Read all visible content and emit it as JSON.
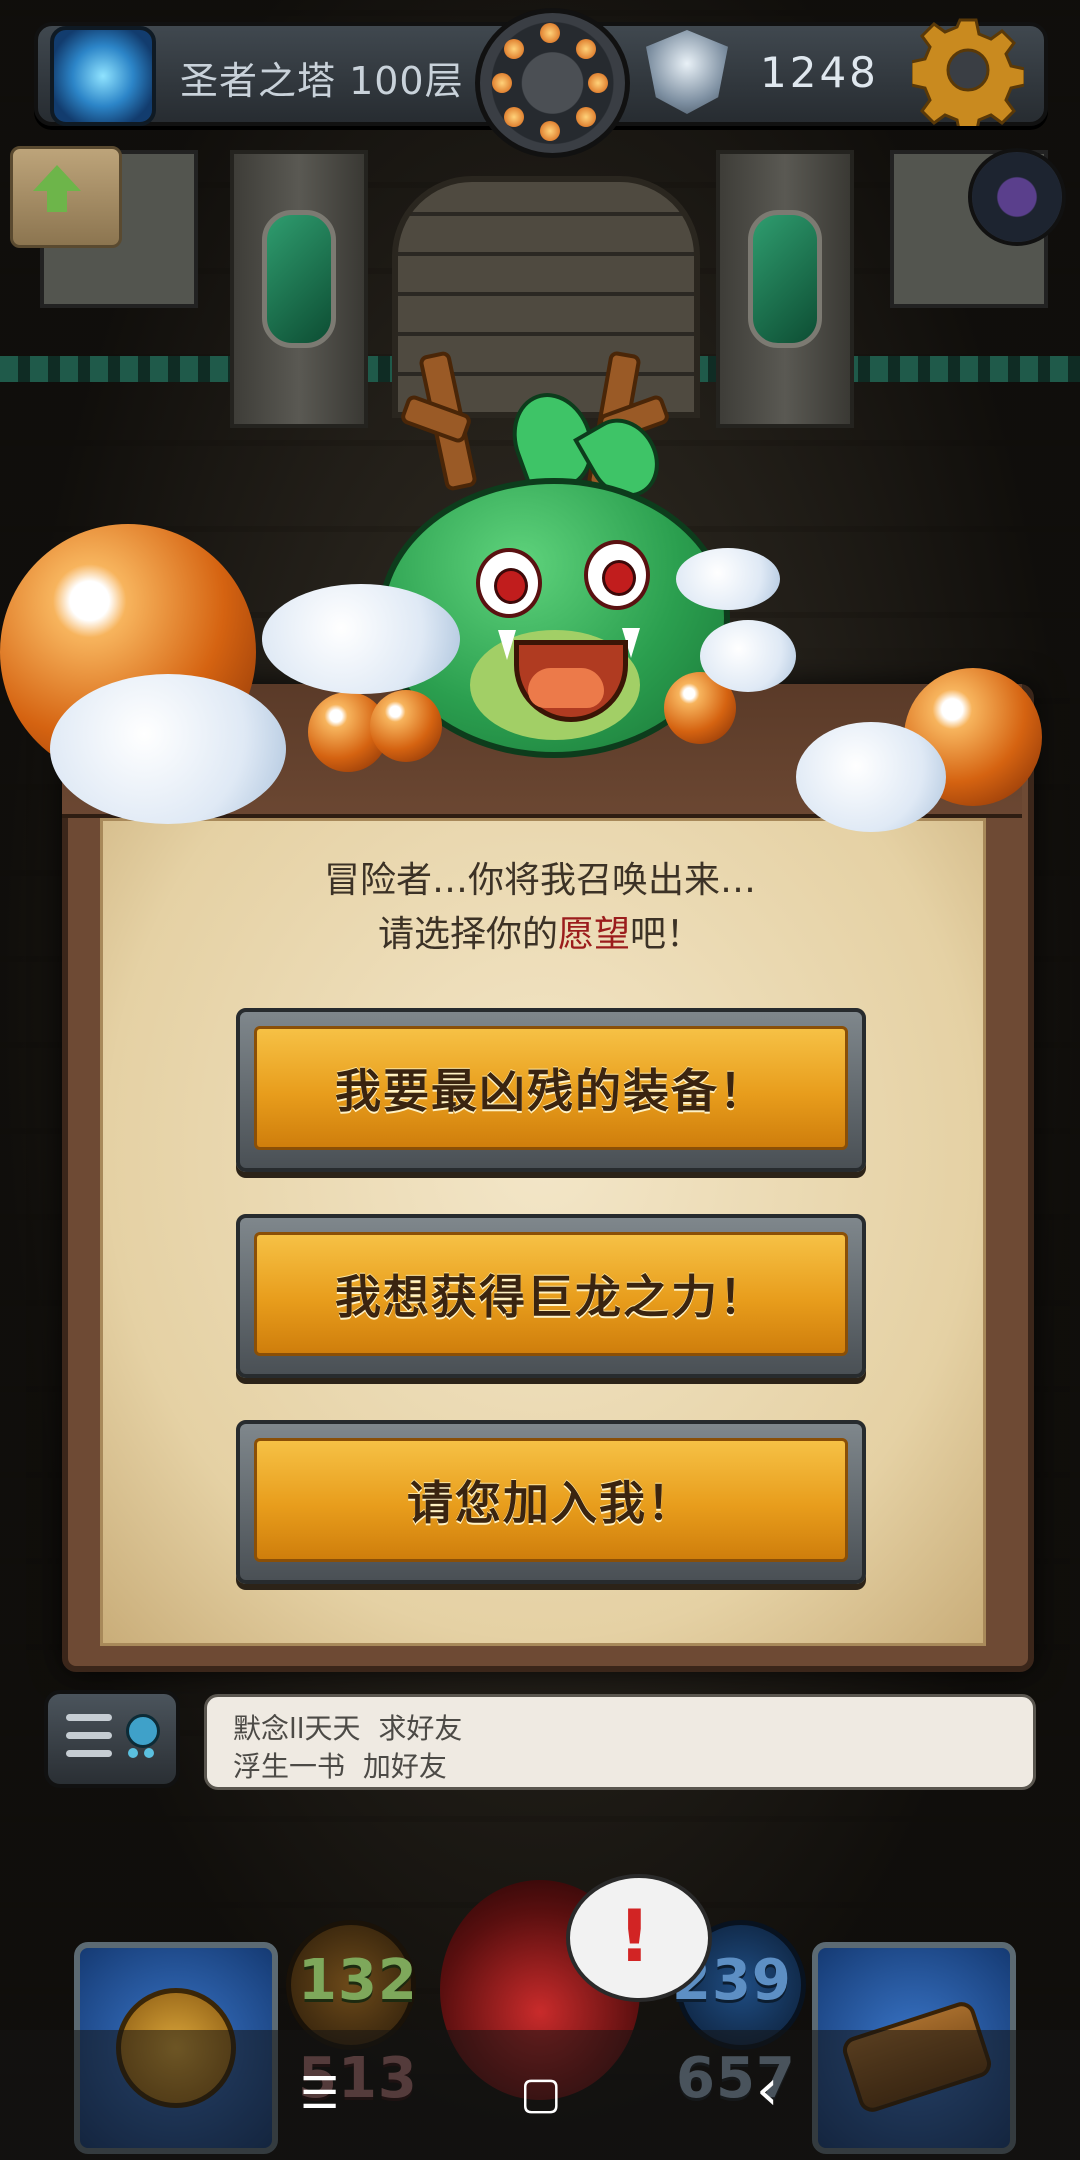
{
  "hud": {
    "title": "圣者之塔 100层",
    "score": "1248"
  },
  "dialog": {
    "prompt_line1": "冒险者…你将我召唤出来…",
    "prompt_line2_pre": "请选择你的",
    "prompt_line2_highlight": "愿望",
    "prompt_line2_post": "吧！",
    "options": [
      {
        "label": "我要最凶残的装备！"
      },
      {
        "label": "我想获得巨龙之力！"
      },
      {
        "label": "请您加入我！"
      }
    ]
  },
  "chat": {
    "messages": [
      {
        "user": "默念ll天天",
        "text": "求好友"
      },
      {
        "user": "浮生一书",
        "text": "加好友"
      }
    ]
  },
  "stats": {
    "left_top": "132",
    "left_bottom": "513",
    "right_top": "239",
    "right_bottom": "657"
  },
  "alert": {
    "symbol": "!"
  },
  "navbar": {
    "menu": "☰",
    "home": "▢",
    "back": "‹"
  },
  "colors": {
    "highlight": "#9b1c1c",
    "button_gold": "#e89d1c",
    "stat_green": "#5a8a3a",
    "stat_blue": "#3d6fa8"
  }
}
